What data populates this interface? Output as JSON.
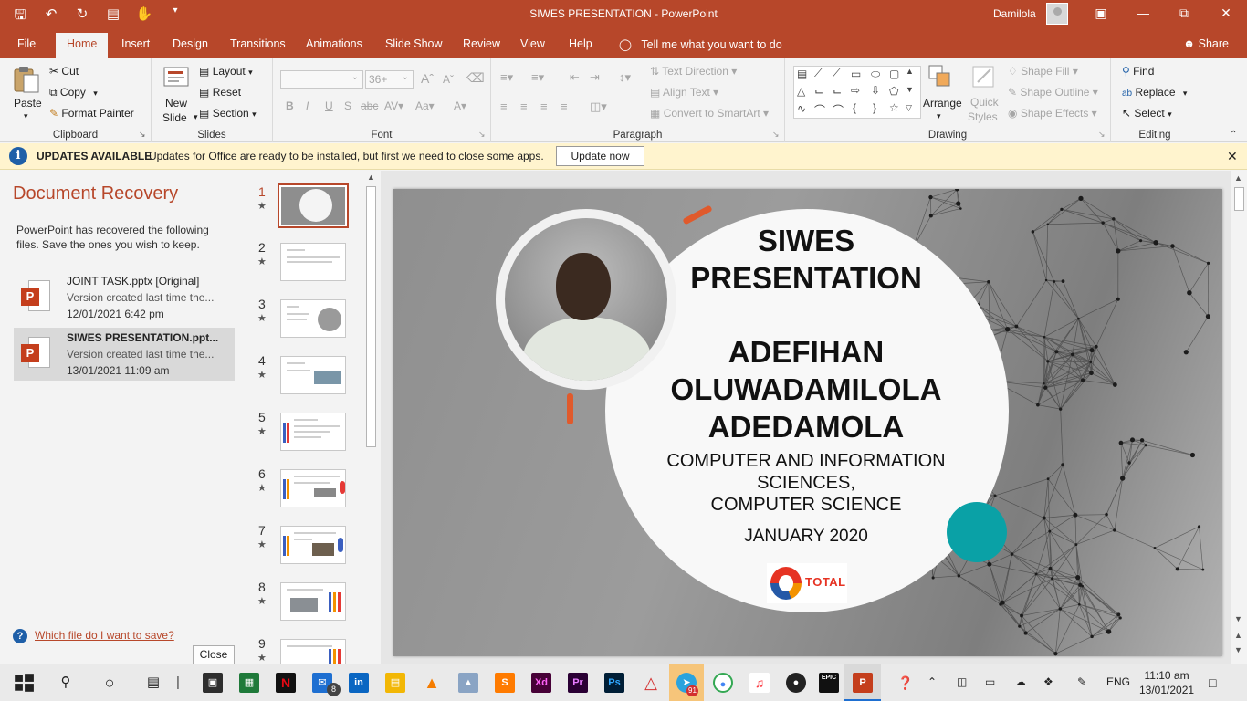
{
  "window": {
    "title": "SIWES PRESENTATION  -  PowerPoint",
    "user": "Damilola"
  },
  "tabs": [
    "File",
    "Home",
    "Insert",
    "Design",
    "Transitions",
    "Animations",
    "Slide Show",
    "Review",
    "View",
    "Help"
  ],
  "active_tab": "Home",
  "tell_me": "Tell me what you want to do",
  "share": "Share",
  "ribbon": {
    "clipboard": {
      "paste": "Paste",
      "cut": "Cut",
      "copy": "Copy",
      "format_painter": "Format Painter",
      "label": "Clipboard"
    },
    "slides": {
      "new_slide_1": "New",
      "new_slide_2": "Slide",
      "layout": "Layout",
      "reset": "Reset",
      "section": "Section",
      "label": "Slides"
    },
    "font": {
      "size": "36+",
      "label": "Font"
    },
    "paragraph": {
      "text_direction": "Text Direction",
      "align_text": "Align Text",
      "convert": "Convert to SmartArt",
      "label": "Paragraph"
    },
    "drawing": {
      "arrange": "Arrange",
      "quick_styles_1": "Quick",
      "quick_styles_2": "Styles",
      "shape_fill": "Shape Fill",
      "shape_outline": "Shape Outline",
      "shape_effects": "Shape Effects",
      "label": "Drawing"
    },
    "editing": {
      "find": "Find",
      "replace": "Replace",
      "select": "Select",
      "label": "Editing"
    }
  },
  "update_bar": {
    "title": "UPDATES AVAILABLE",
    "message": "Updates for Office are ready to be installed, but first we need to close some apps.",
    "button": "Update now"
  },
  "recovery": {
    "title": "Document Recovery",
    "description": "PowerPoint has recovered the following files.  Save the ones you wish to keep.",
    "files": [
      {
        "name": "JOINT TASK.pptx  [Original]",
        "version": "Version created last time the...",
        "date": "12/01/2021 6:42 pm"
      },
      {
        "name": "SIWES PRESENTATION.ppt...",
        "version": "Version created last time the...",
        "date": "13/01/2021 11:09 am"
      }
    ],
    "help_link": "Which file do I want to save?",
    "close": "Close"
  },
  "thumbnails": [
    "1",
    "2",
    "3",
    "4",
    "5",
    "6",
    "7",
    "8",
    "9"
  ],
  "slide": {
    "title_line1": "SIWES",
    "title_line2": "PRESENTATION",
    "name_line1": "ADEFIHAN",
    "name_line2": "OLUWADAMILOLA",
    "name_line3": "ADEDAMOLA",
    "dept_line1": "COMPUTER AND INFORMATION",
    "dept_line2": "SCIENCES,",
    "dept_line3": "COMPUTER SCIENCE",
    "date": "JANUARY 2020",
    "logo_text": "TOTAL"
  },
  "taskbar": {
    "mail_badge": "8",
    "telegram_badge": "91",
    "language": "ENG",
    "time": "11:10 am",
    "date": "13/01/2021"
  },
  "colors": {
    "accent": "#b7472a",
    "teal": "#0aa1a6",
    "update_bg": "#fff4ce"
  }
}
